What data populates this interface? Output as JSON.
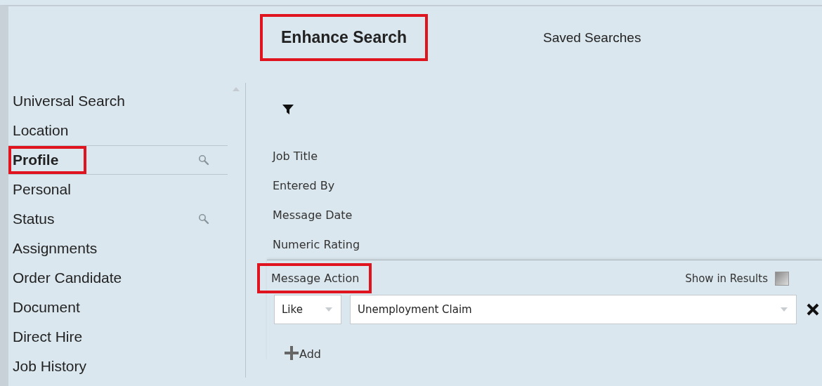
{
  "tabs": [
    {
      "label": "Enhance Search",
      "selected": true,
      "highlighted": true
    },
    {
      "label": "Saved Searches",
      "selected": false,
      "highlighted": false
    }
  ],
  "sidebar": {
    "items": [
      {
        "label": "Universal Search",
        "selected": false,
        "highlighted": false,
        "search_icon": false
      },
      {
        "label": "Location",
        "selected": false,
        "highlighted": false,
        "search_icon": false
      },
      {
        "label": "Profile",
        "selected": true,
        "highlighted": true,
        "search_icon": true
      },
      {
        "label": "Personal",
        "selected": false,
        "highlighted": false,
        "search_icon": false
      },
      {
        "label": "Status",
        "selected": false,
        "highlighted": false,
        "search_icon": true
      },
      {
        "label": "Assignments",
        "selected": false,
        "highlighted": false,
        "search_icon": false
      },
      {
        "label": "Order Candidate",
        "selected": false,
        "highlighted": false,
        "search_icon": false
      },
      {
        "label": "Document",
        "selected": false,
        "highlighted": false,
        "search_icon": false
      },
      {
        "label": "Direct Hire",
        "selected": false,
        "highlighted": false,
        "search_icon": false
      },
      {
        "label": "Job History",
        "selected": false,
        "highlighted": false,
        "search_icon": false
      }
    ]
  },
  "fields": [
    {
      "label": "Job Title"
    },
    {
      "label": "Entered By"
    },
    {
      "label": "Message Date"
    },
    {
      "label": "Numeric Rating"
    }
  ],
  "criterion": {
    "label": "Message Action",
    "highlighted": true,
    "show_in_results": {
      "label": "Show in Results",
      "checked": false
    },
    "operator": "Like",
    "value": "Unemployment Claim"
  },
  "add_label": "Add"
}
